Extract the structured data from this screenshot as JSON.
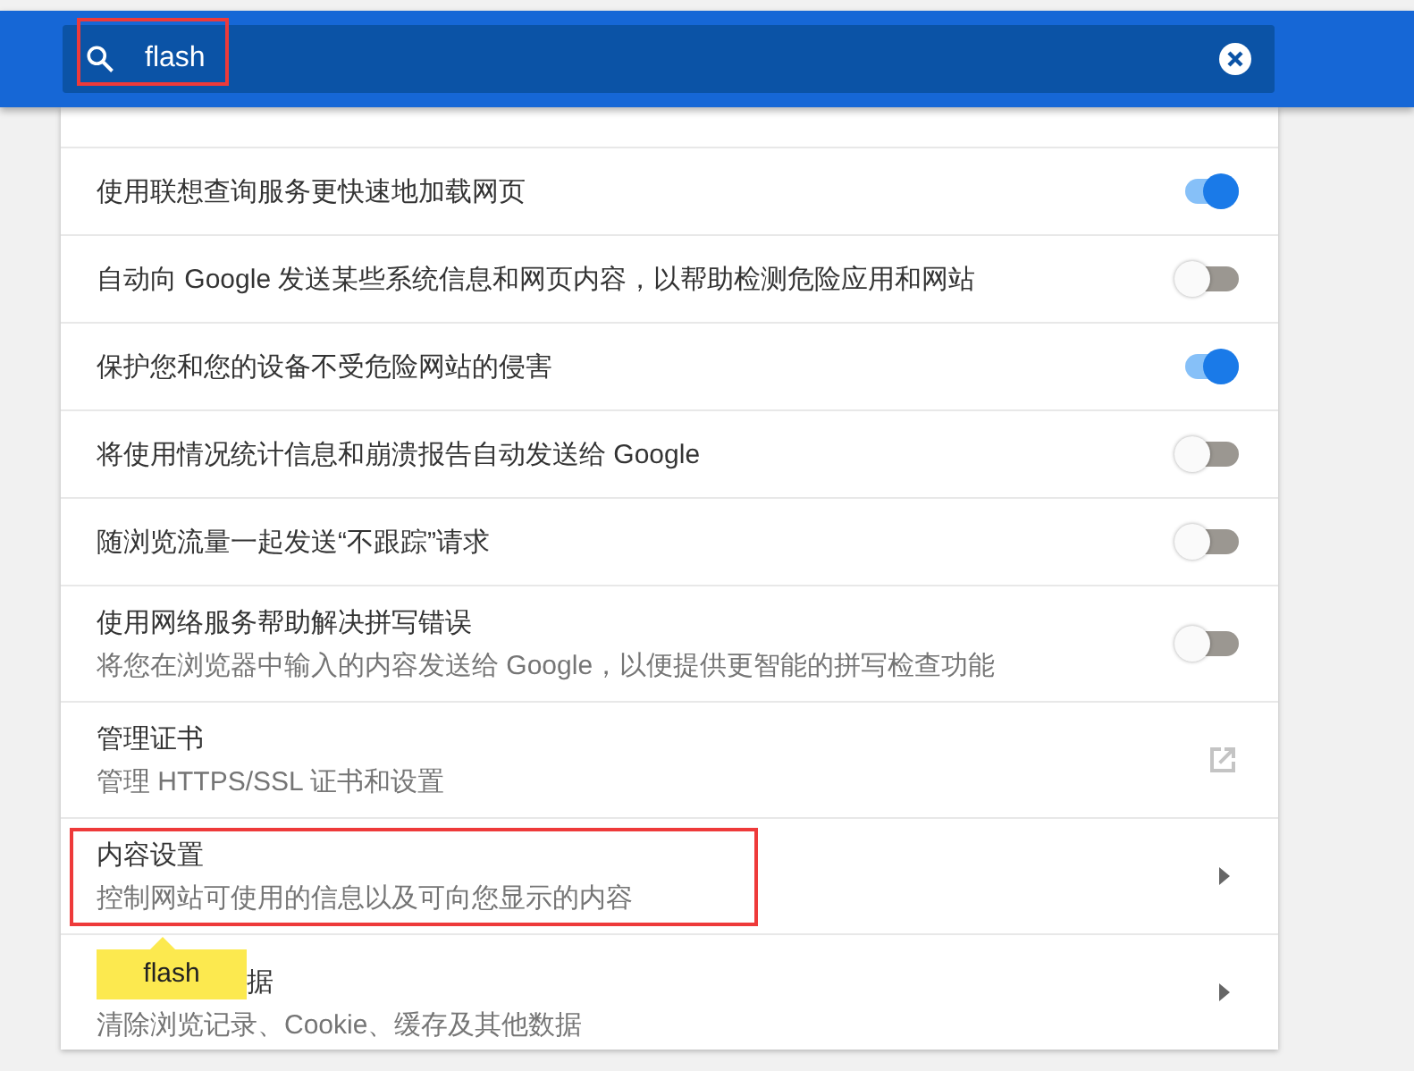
{
  "search": {
    "value": "flash",
    "highlighted": true
  },
  "rows": [
    {
      "kind": "toggle",
      "title": "使用联想查询服务更快速地加载网页",
      "on": true
    },
    {
      "kind": "toggle",
      "title": "自动向 Google 发送某些系统信息和网页内容，以帮助检测危险应用和网站",
      "on": false
    },
    {
      "kind": "toggle",
      "title": "保护您和您的设备不受危险网站的侵害",
      "on": true
    },
    {
      "kind": "toggle",
      "title": "将使用情况统计信息和崩溃报告自动发送给 Google",
      "on": false
    },
    {
      "kind": "toggle",
      "title": "随浏览流量一起发送“不跟踪”请求",
      "on": false
    },
    {
      "kind": "toggle",
      "title": "使用网络服务帮助解决拼写错误",
      "subtitle": "将您在浏览器中输入的内容发送给 Google，以便提供更智能的拼写检查功能",
      "on": false
    },
    {
      "kind": "external",
      "title": "管理证书",
      "subtitle": "管理 HTTPS/SSL 证书和设置"
    },
    {
      "kind": "arrow",
      "title": "内容设置",
      "subtitle": "控制网站可使用的信息以及可向您显示的内容",
      "highlighted": true
    },
    {
      "kind": "arrow",
      "title": "据",
      "subtitle": "清除浏览记录、Cookie、缓存及其他数据",
      "bubble": "flash"
    }
  ]
}
